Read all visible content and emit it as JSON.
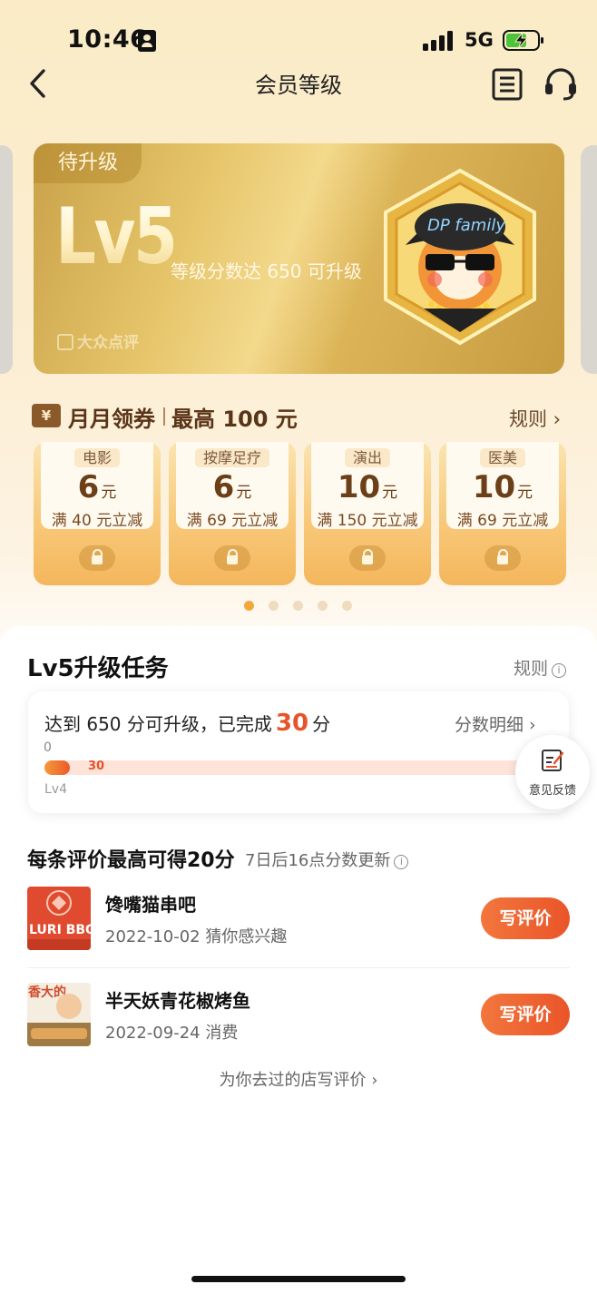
{
  "status": {
    "time": "10:46",
    "network": "5G"
  },
  "nav": {
    "title": "会员等级"
  },
  "level_card": {
    "badge": "待升级",
    "level": "Lv5",
    "description": "等级分数达 650 可升级",
    "brand": "大众点评",
    "mascot_text": "DP family"
  },
  "coupons": {
    "icon_text": "¥",
    "title": "月月领券",
    "max": "最高 100 元",
    "rule": "规则",
    "items": [
      {
        "category": "电影",
        "amount": "6",
        "unit": "元",
        "condition": "满 40 元立减"
      },
      {
        "category": "按摩足疗",
        "amount": "6",
        "unit": "元",
        "condition": "满 69 元立减"
      },
      {
        "category": "演出",
        "amount": "10",
        "unit": "元",
        "condition": "满 150 元立减"
      },
      {
        "category": "医美",
        "amount": "10",
        "unit": "元",
        "condition": "满 69 元立减"
      }
    ],
    "pages": 5,
    "active_page": 0
  },
  "task": {
    "title": "Lv5升级任务",
    "rule": "规则",
    "info_glyph": "i",
    "progress_prefix": "达到 650 分可升级，已完成",
    "progress_score": "30",
    "progress_suffix": "分",
    "detail": "分数明细",
    "min_label": "0",
    "current_value_label": "30",
    "current_level": "Lv4",
    "progress_fraction": 0.046
  },
  "feedback": {
    "label": "意见反馈"
  },
  "reviews": {
    "heading": "每条评价最高可得20分",
    "subheading": "7日后16点分数更新",
    "info_glyph": "i",
    "items": [
      {
        "name": "馋嘴猫串吧",
        "meta": "2022-10-02 猜你感兴趣",
        "button": "写评价",
        "thumb_text": "LURI BBQ"
      },
      {
        "name": "半天妖青花椒烤鱼",
        "meta": "2022-09-24 消费",
        "button": "写评价",
        "thumb_text": "香大的"
      }
    ],
    "go_review": "为你去过的店写评价 ›"
  },
  "colors": {
    "accent": "#e7532a",
    "gold": "#d9b157",
    "coupon_text": "#6b3f18",
    "header_bg": "#fbecc7"
  }
}
